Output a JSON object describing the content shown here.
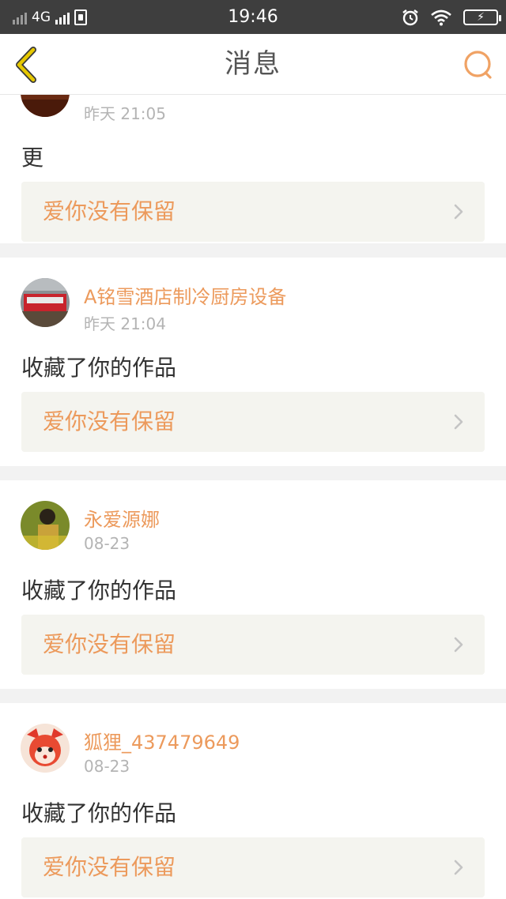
{
  "status_bar": {
    "network": "4G",
    "time": "19:46"
  },
  "header": {
    "title": "消息"
  },
  "items": [
    {
      "time": "昨天 21:05",
      "action": "更",
      "work_title": "爱你没有保留"
    },
    {
      "user": "A铭雪酒店制冷厨房设备",
      "time": "昨天 21:04",
      "action": "收藏了你的作品",
      "work_title": "爱你没有保留"
    },
    {
      "user": "永爱源娜",
      "time": "08-23",
      "action": "收藏了你的作品",
      "work_title": "爱你没有保留"
    },
    {
      "user": "狐狸_437479649",
      "time": "08-23",
      "action": "收藏了你的作品",
      "work_title": "爱你没有保留"
    }
  ],
  "colors": {
    "accent": "#ec9a5c",
    "back_icon": "#d6b000",
    "search_icon": "#f0a264",
    "status_bar_bg": "#3e3e3e"
  },
  "icons": {
    "back": "chevron-left-icon",
    "search": "search-icon",
    "row_arrow": "chevron-right-icon",
    "battery": "battery-charging-icon",
    "wifi": "wifi-icon",
    "alarm": "alarm-icon",
    "sim": "sim-card-icon"
  }
}
